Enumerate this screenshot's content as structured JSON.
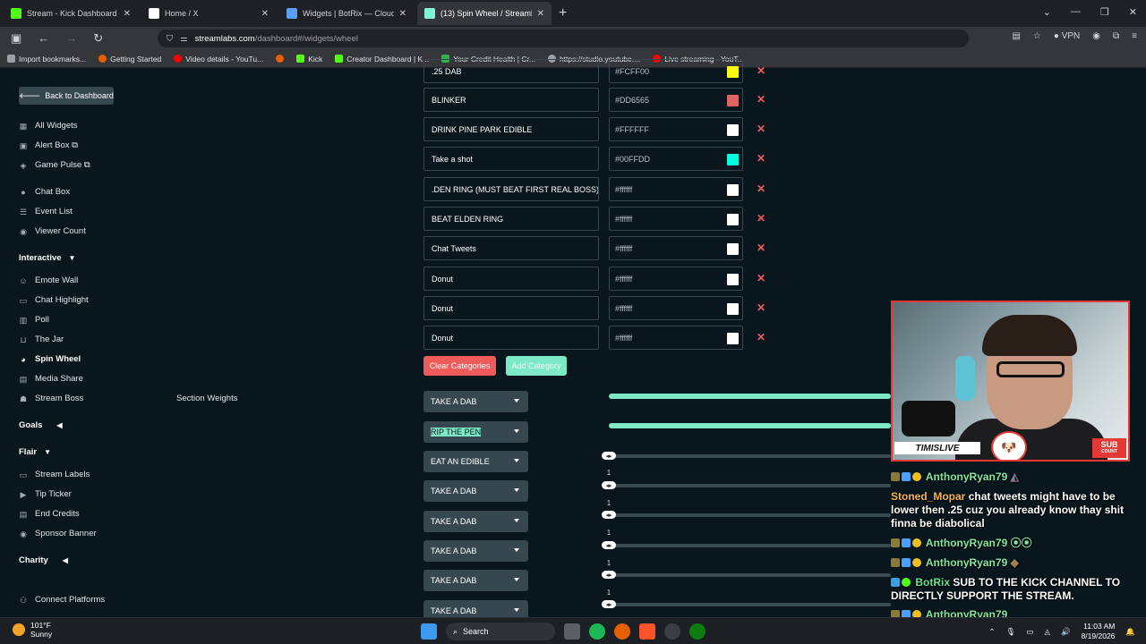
{
  "browser": {
    "tabs": [
      {
        "title": "Stream - Kick Dashboard",
        "favicon_color": "#53fc18"
      },
      {
        "title": "Home / X",
        "favicon_color": "#ffffff"
      },
      {
        "title": "Widgets | BotRix — Cloud Strea",
        "favicon_color": "#5aa0ff"
      },
      {
        "title": "(13) Spin Wheel / Streamlabs",
        "favicon_color": "#80f5d2"
      }
    ],
    "url_domain": "streamlabs.com",
    "url_path": "/dashboard#/widgets/wheel",
    "vpn_label": "VPN",
    "bookmarks": [
      {
        "label": "Import bookmarks...",
        "color": "#9aa0a6"
      },
      {
        "label": "Getting Started",
        "color": "#e66000"
      },
      {
        "label": "Video details - YouTu...",
        "color": "#ff0000"
      },
      {
        "label": "",
        "color": "#e66000"
      },
      {
        "label": "Kick",
        "color": "#53fc18"
      },
      {
        "label": "Creator Dashboard | K...",
        "color": "#53fc18"
      },
      {
        "label": "Your Credit Health | Cr...",
        "color": "#2cb34a"
      },
      {
        "label": "https://studio.youtube....",
        "color": "#9aa0a6"
      },
      {
        "label": "Live streaming - YouT...",
        "color": "#ff0000"
      }
    ]
  },
  "sidebar": {
    "back_label": "Back to Dashboard",
    "items": [
      {
        "label": "All Widgets",
        "icon": "grid-icon"
      },
      {
        "label": "Alert Box ⧉",
        "icon": "alert-icon"
      },
      {
        "label": "Game Pulse ⧉",
        "icon": "gamepad-icon"
      },
      {
        "label": "Chat Box",
        "icon": "chat-icon"
      },
      {
        "label": "Event List",
        "icon": "list-icon"
      },
      {
        "label": "Viewer Count",
        "icon": "eye-icon"
      }
    ],
    "interactive_header": "Interactive",
    "interactive_items": [
      {
        "label": "Emote Wall",
        "icon": "emote-icon"
      },
      {
        "label": "Chat Highlight",
        "icon": "highlight-icon"
      },
      {
        "label": "Poll",
        "icon": "poll-icon"
      },
      {
        "label": "The Jar",
        "icon": "jar-icon"
      },
      {
        "label": "Spin Wheel",
        "icon": "wheel-icon"
      },
      {
        "label": "Media Share",
        "icon": "media-icon"
      },
      {
        "label": "Stream Boss",
        "icon": "boss-icon"
      }
    ],
    "goals_header": "Goals",
    "flair_header": "Flair",
    "flair_items": [
      {
        "label": "Stream Labels",
        "icon": "label-icon"
      },
      {
        "label": "Tip Ticker",
        "icon": "ticker-icon"
      },
      {
        "label": "End Credits",
        "icon": "credits-icon"
      },
      {
        "label": "Sponsor Banner",
        "icon": "banner-icon"
      }
    ],
    "charity_header": "Charity",
    "connect_label": "Connect Platforms"
  },
  "section_weights_label": "Section Weights",
  "categories": [
    {
      "name": ".25 DAB",
      "color": "#FCFF00"
    },
    {
      "name": "BLINKER",
      "color": "#DD6565"
    },
    {
      "name": "DRINK PINE PARK EDIBLE",
      "color": "#FFFFFF"
    },
    {
      "name": "Take a shot",
      "color": "#00FFDD"
    },
    {
      "name": ".DEN RING (MUST BEAT FIRST REAL BOSS)",
      "color": "#ffffff"
    },
    {
      "name": "BEAT ELDEN RING",
      "color": "#ffffff"
    },
    {
      "name": "Chat Tweets",
      "color": "#ffffff"
    },
    {
      "name": "Donut",
      "color": "#ffffff"
    },
    {
      "name": "Donut",
      "color": "#ffffff"
    },
    {
      "name": "Donut",
      "color": "#ffffff"
    }
  ],
  "clear_label": "Clear Categories",
  "add_label": "Add Category",
  "weights": [
    {
      "label": "TAKE A DAB",
      "value": "",
      "level": 1.0
    },
    {
      "label": "RIP THE PEN",
      "value": "",
      "level": 1.0
    },
    {
      "label": "EAT AN EDIBLE",
      "value": "1",
      "level": 0.0
    },
    {
      "label": "TAKE A DAB",
      "value": "1",
      "level": 0.0
    },
    {
      "label": "TAKE A DAB",
      "value": "1",
      "level": 0.0
    },
    {
      "label": "TAKE A DAB",
      "value": "1",
      "level": 0.0
    },
    {
      "label": "TAKE A DAB",
      "value": "1",
      "level": 0.0
    },
    {
      "label": "TAKE A DAB",
      "value": "",
      "level": 0.0
    }
  ],
  "overlay": {
    "brand": "TIMISLIVE",
    "sub_count_top": "SUB",
    "sub_count_bottom": "COUNT"
  },
  "chat": [
    {
      "user": "AnthonyRyan79",
      "msg": ""
    },
    {
      "user": "Stoned_Mopar",
      "msg": "chat tweets might have to be lower then .25 cuz you already know thay shit finna be diabolical"
    },
    {
      "user": "AnthonyRyan79",
      "msg": ""
    },
    {
      "user": "AnthonyRyan79",
      "msg": ""
    },
    {
      "user": "BotRix",
      "msg": "SUB TO THE KICK CHANNEL TO DIRECTLY SUPPORT THE STREAM."
    },
    {
      "user": "AnthonyRyan79",
      "msg": ""
    }
  ],
  "taskbar": {
    "temp": "101°F",
    "condition": "Sunny",
    "search_label": "Search",
    "time": "11:03 AM",
    "date": "8/19/2026"
  }
}
